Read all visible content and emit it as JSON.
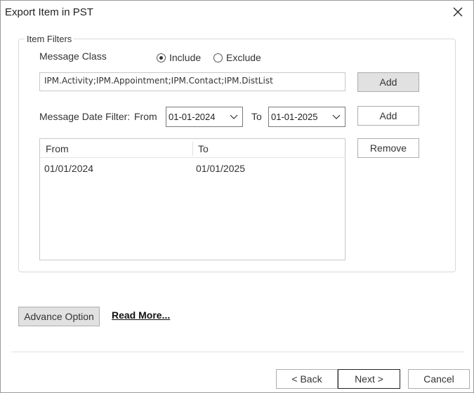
{
  "window": {
    "title": "Export Item in PST"
  },
  "item_filters": {
    "legend": "Item Filters",
    "message_class_label": "Message Class",
    "include_label": "Include",
    "exclude_label": "Exclude",
    "selected_mode": "include",
    "message_class_value": "IPM.Activity;IPM.Appointment;IPM.Contact;IPM.DistList",
    "add_class_label": "Add",
    "date_filter_label": "Message Date Filter:",
    "from_label": "From",
    "from_date": "01-01-2024",
    "to_label": "To",
    "to_date": "01-01-2025",
    "add_date_label": "Add",
    "remove_label": "Remove",
    "list": {
      "columns": [
        "From",
        "To"
      ],
      "rows": [
        {
          "from": "01/01/2024",
          "to": "01/01/2025"
        }
      ]
    }
  },
  "advance_option_label": "Advance Option",
  "read_more_label": "Read More...",
  "footer": {
    "back_label": "< Back",
    "next_label": "Next >",
    "cancel_label": "Cancel"
  },
  "icons": {
    "close": "close-icon",
    "dropdown": "chevron-down-icon"
  }
}
